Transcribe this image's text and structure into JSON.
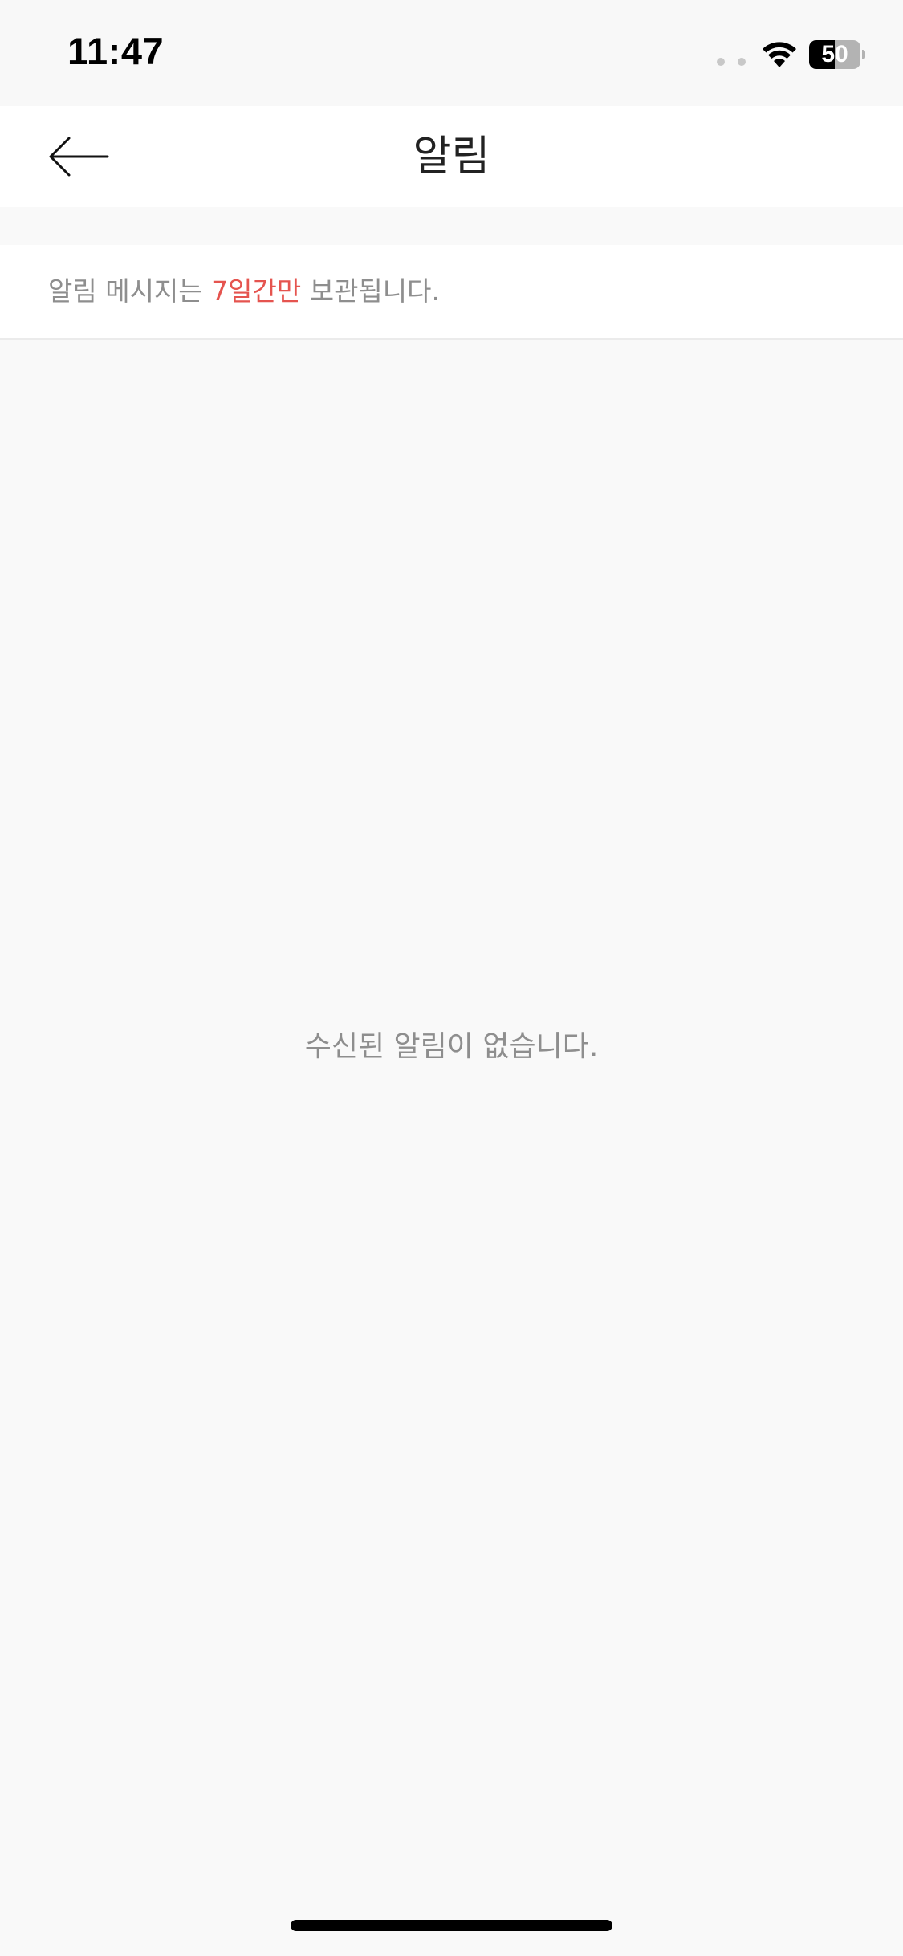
{
  "status_bar": {
    "time": "11:47",
    "battery_level": "50",
    "battery_fraction": 0.5,
    "icons": [
      "signal-icon",
      "wifi-icon",
      "battery-icon"
    ]
  },
  "header": {
    "title": "알림",
    "back_icon": "arrow-left-icon"
  },
  "notice": {
    "prefix": "알림 메시지는 ",
    "highlight": "7일간만",
    "suffix": " 보관됩니다.",
    "highlight_color": "#e5544f"
  },
  "empty_state": {
    "message": "수신된 알림이 없습니다."
  }
}
